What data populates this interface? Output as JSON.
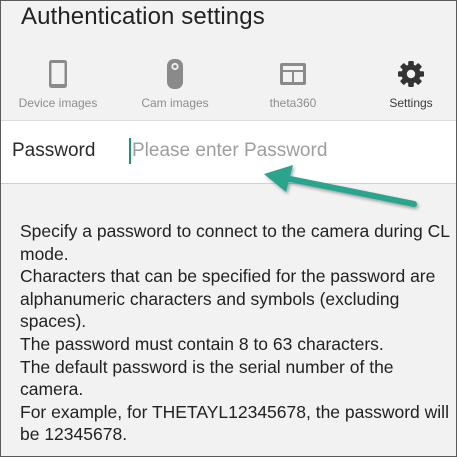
{
  "header": {
    "title": "Authentication settings"
  },
  "tabs": [
    {
      "label": "Device images",
      "icon": "smartphone-icon",
      "active": false
    },
    {
      "label": "Cam images",
      "icon": "camera-icon",
      "active": false
    },
    {
      "label": "theta360",
      "icon": "gallery-icon",
      "active": false
    },
    {
      "label": "Settings",
      "icon": "gear-icon",
      "active": true
    }
  ],
  "password": {
    "label": "Password",
    "value": "",
    "placeholder": "Please enter Password"
  },
  "description": {
    "lines": [
      "Specify a password to connect to the camera during CL mode.",
      "Characters that can be specified for the password are alphanumeric characters and symbols (excluding spaces).",
      "The password must contain 8 to 63 characters.",
      "The default password is the serial number of the camera.",
      "For example, for THETAYL12345678, the password will be 12345678."
    ]
  },
  "colors": {
    "annotation_arrow": "#2aa48c",
    "caret": "#1f8f80",
    "inactive_tab": "#8d8d8d",
    "active_tab": "#3a3a3a"
  }
}
